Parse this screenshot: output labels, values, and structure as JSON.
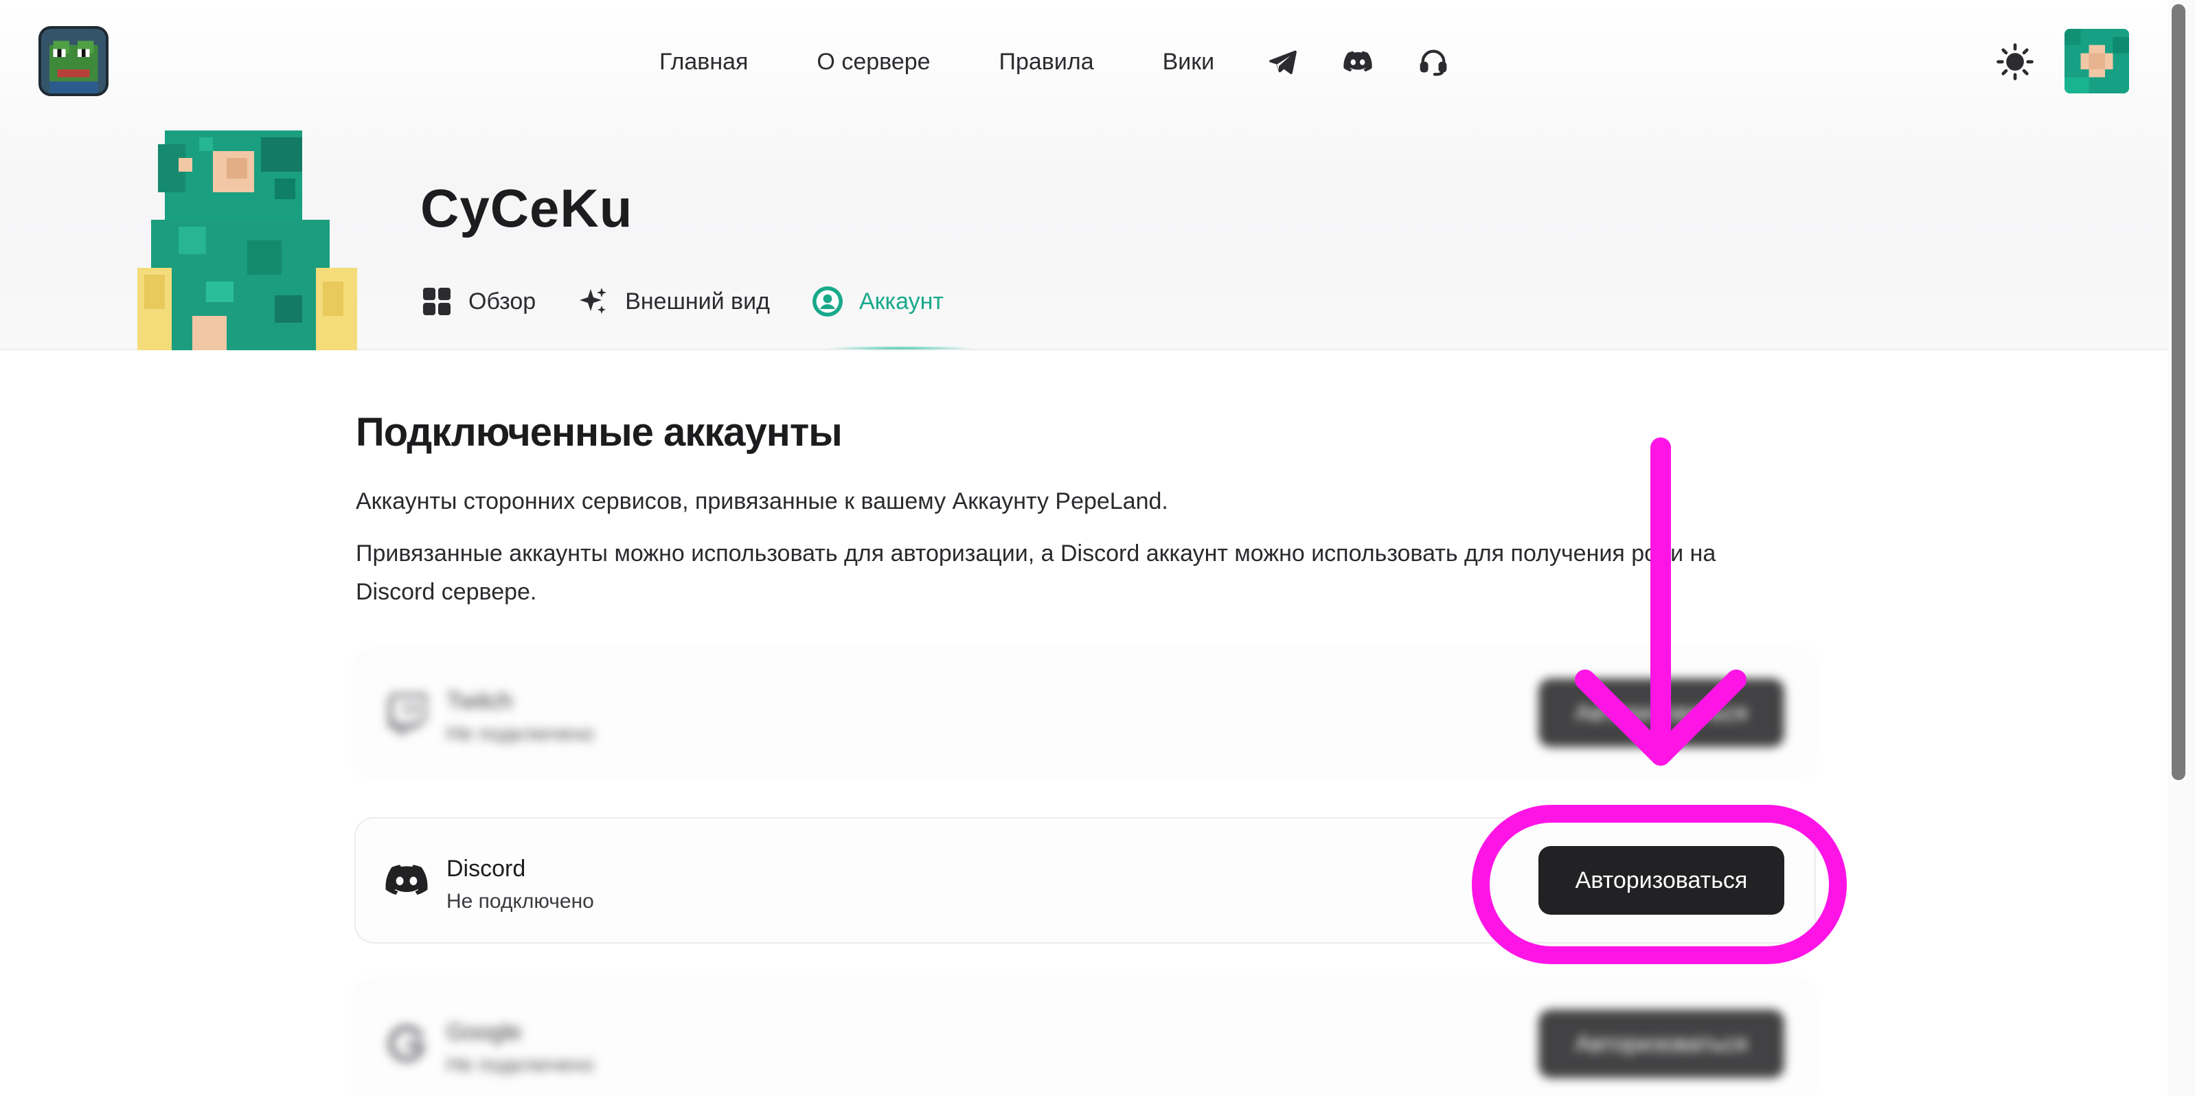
{
  "header": {
    "nav": [
      {
        "label": "Главная"
      },
      {
        "label": "О сервере"
      },
      {
        "label": "Правила"
      },
      {
        "label": "Вики"
      }
    ],
    "nav_icons": [
      "telegram-icon",
      "discord-icon",
      "headset-icon"
    ],
    "theme_icon": "sun-icon"
  },
  "profile": {
    "username": "CyCeKu",
    "tabs": [
      {
        "label": "Обзор",
        "icon": "grid-icon",
        "active": false
      },
      {
        "label": "Внешний вид",
        "icon": "sparkles-icon",
        "active": false
      },
      {
        "label": "Аккаунт",
        "icon": "account-icon",
        "active": true
      }
    ]
  },
  "connected": {
    "title": "Подключенные аккаунты",
    "description_1": "Аккаунты сторонних сервисов, привязанные к вашему Аккаунту PepeLand.",
    "description_2": "Привязанные аккаунты можно использовать для авторизации, а Discord аккаунт можно использовать для получения роли на Discord сервере.",
    "services": [
      {
        "name": "Twitch",
        "status": "Не подключено",
        "button": "Авторизоваться",
        "icon": "twitch-icon",
        "blurred": true
      },
      {
        "name": "Discord",
        "status": "Не подключено",
        "button": "Авторизоваться",
        "icon": "discord-icon",
        "blurred": false
      },
      {
        "name": "Google",
        "status": "Не подключено",
        "button": "Авторизоваться",
        "icon": "google-icon",
        "blurred": true
      }
    ]
  },
  "colors": {
    "accent": "#18a98a",
    "annotation": "#ff14e6",
    "button": "#222224"
  }
}
